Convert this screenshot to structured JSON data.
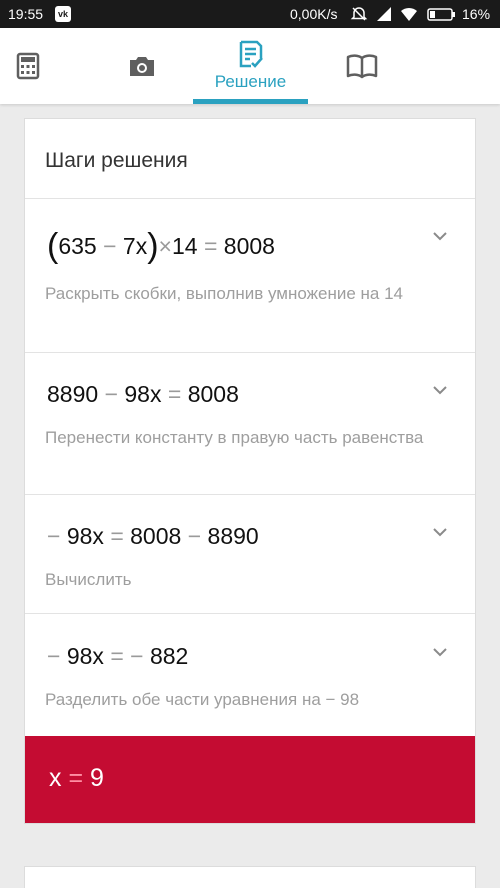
{
  "status_bar": {
    "time": "19:55",
    "vk_badge": "vk",
    "network_speed": "0,00K/s",
    "battery": "16%"
  },
  "nav": {
    "tabs": [
      {
        "id": "calculator",
        "icon": "calculator-icon"
      },
      {
        "id": "camera",
        "icon": "camera-icon"
      },
      {
        "id": "solution",
        "icon": "solution-icon",
        "label": "Решение",
        "active": true
      },
      {
        "id": "book",
        "icon": "book-icon"
      }
    ]
  },
  "card": {
    "title": "Шаги решения",
    "steps": [
      {
        "eq": {
          "lparen": "(",
          "a": "635",
          "minus": "−",
          "b": "7",
          "x": "x",
          "rparen": ")",
          "times": "×",
          "c": "14",
          "eq": "=",
          "d": "8008"
        },
        "description": "Раскрыть скобки, выполнив умножение на 14"
      },
      {
        "eq": {
          "a": "8890",
          "minus": "−",
          "b": "98",
          "x": "x",
          "eq": "=",
          "d": "8008"
        },
        "description": "Перенести константу в правую часть равенства"
      },
      {
        "eq": {
          "neg": "−",
          "b": "98",
          "x": "x",
          "eq": "=",
          "c": "8008",
          "minus": "−",
          "d": "8890"
        },
        "description": "Вычислить"
      },
      {
        "eq": {
          "neg": "−",
          "b": "98",
          "x": "x",
          "eq": "=",
          "neg2": "−",
          "d": "882"
        },
        "description": "Разделить обе части уравнения на − 98"
      }
    ],
    "answer": {
      "var": "x",
      "eq": "=",
      "value": "9"
    }
  },
  "colors": {
    "accent": "#2aa1c0",
    "answer_bg": "#c40c32",
    "status_bar": "#1a1a1a"
  }
}
